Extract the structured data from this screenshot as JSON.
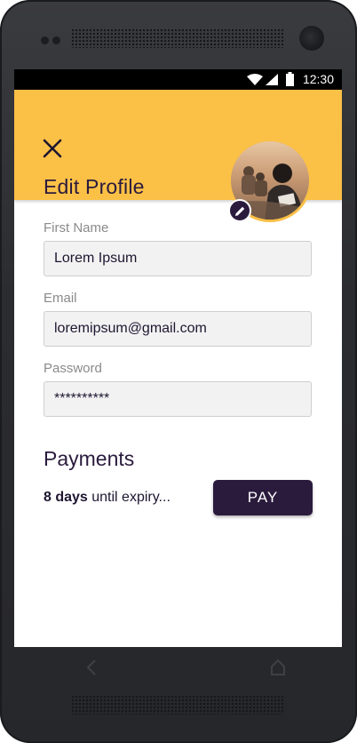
{
  "status_bar": {
    "time": "12:30",
    "icons": [
      "wifi-icon",
      "signal-icon",
      "battery-icon"
    ]
  },
  "header": {
    "close_icon": "close-icon",
    "title": "Edit Profile",
    "avatar_edit_icon": "pencil-icon",
    "background_color": "#fbc046"
  },
  "form": {
    "first_name": {
      "label": "First Name",
      "value": "Lorem Ipsum"
    },
    "email": {
      "label": "Email",
      "value": "loremipsum@gmail.com"
    },
    "password": {
      "label": "Password",
      "value": "**********"
    }
  },
  "payments": {
    "title": "Payments",
    "expiry_bold": "8 days",
    "expiry_rest": " until expiry...",
    "pay_label": "PAY",
    "button_color": "#2a1b3d"
  },
  "nav_bar": {
    "icons": [
      "back-icon",
      "home-icon"
    ]
  }
}
